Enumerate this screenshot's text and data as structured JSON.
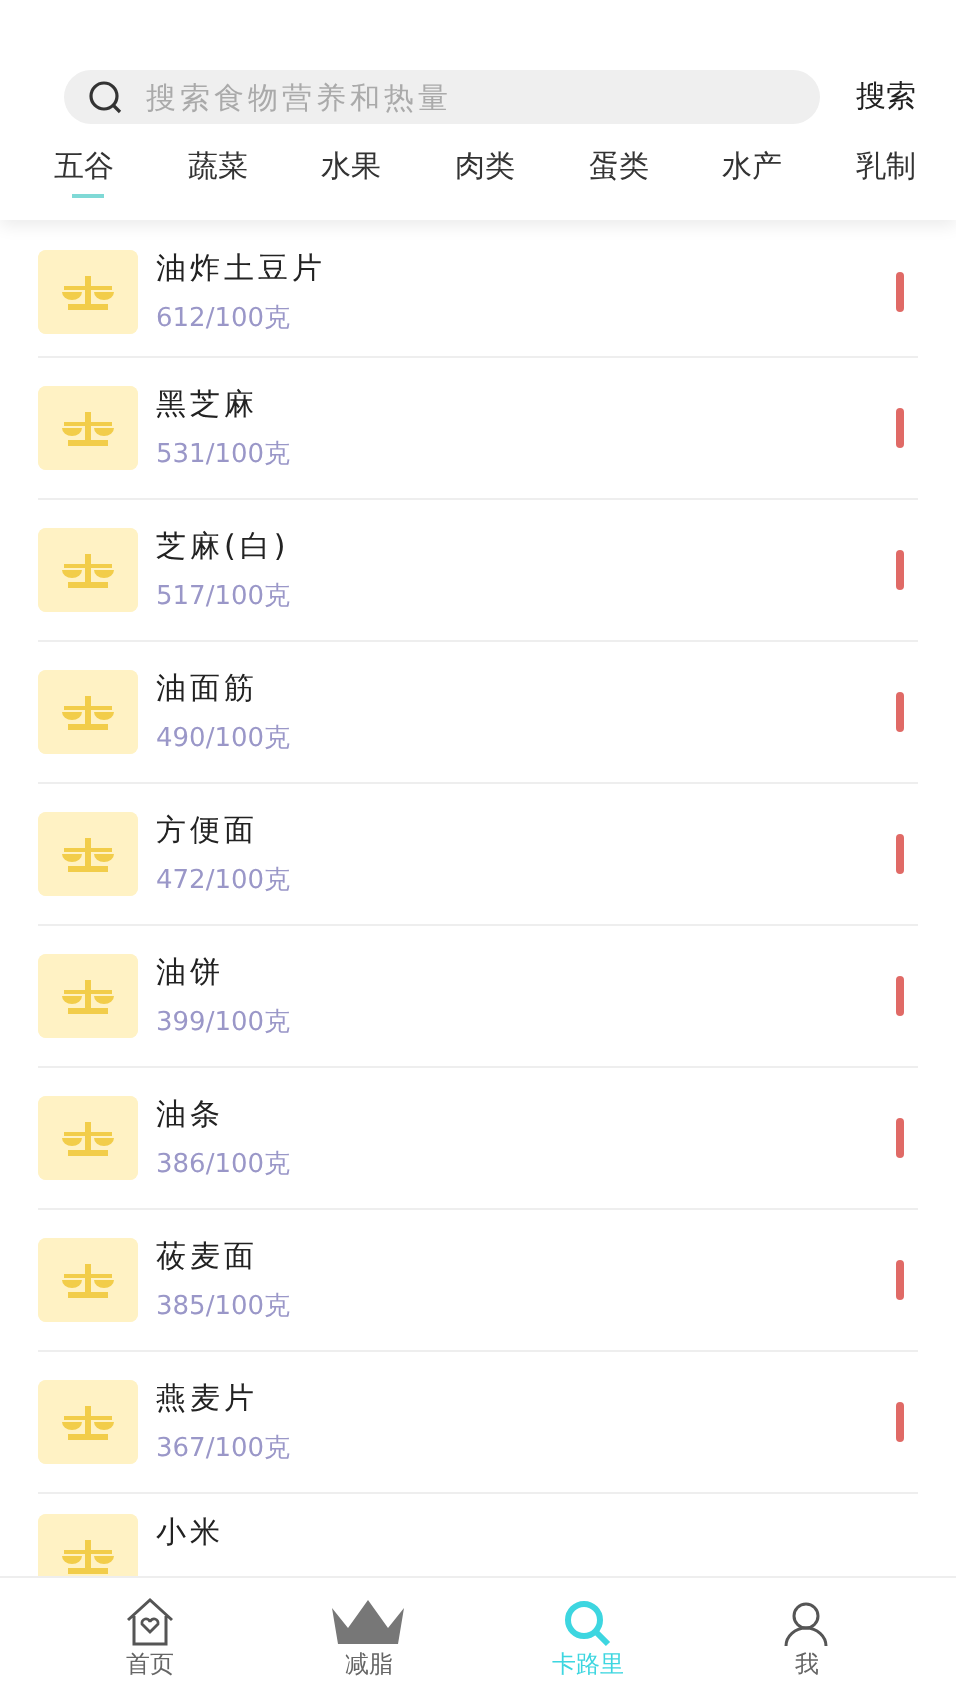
{
  "search": {
    "placeholder": "搜索食物营养和热量",
    "button": "搜索"
  },
  "tabs": [
    {
      "label": "五谷",
      "selected": true
    },
    {
      "label": "蔬菜",
      "selected": false
    },
    {
      "label": "水果",
      "selected": false
    },
    {
      "label": "肉类",
      "selected": false
    },
    {
      "label": "蛋类",
      "selected": false
    },
    {
      "label": "水产",
      "selected": false
    },
    {
      "label": "乳制",
      "selected": false
    }
  ],
  "foods": [
    {
      "name": "油炸土豆片",
      "calories": "612/100克"
    },
    {
      "name": "黑芝麻",
      "calories": "531/100克"
    },
    {
      "name": "芝麻(白)",
      "calories": "517/100克"
    },
    {
      "name": "油面筋",
      "calories": "490/100克"
    },
    {
      "name": "方便面",
      "calories": "472/100克"
    },
    {
      "name": "油饼",
      "calories": "399/100克"
    },
    {
      "name": "油条",
      "calories": "386/100克"
    },
    {
      "name": "莜麦面",
      "calories": "385/100克"
    },
    {
      "name": "燕麦片",
      "calories": "367/100克"
    },
    {
      "name": "小米"
    }
  ],
  "nav": [
    {
      "label": "首页",
      "kind": "home",
      "selected": false
    },
    {
      "label": "减脂",
      "kind": "crown",
      "selected": false
    },
    {
      "label": "卡路里",
      "kind": "search",
      "selected": true
    },
    {
      "label": "我",
      "kind": "person",
      "selected": false
    }
  ]
}
